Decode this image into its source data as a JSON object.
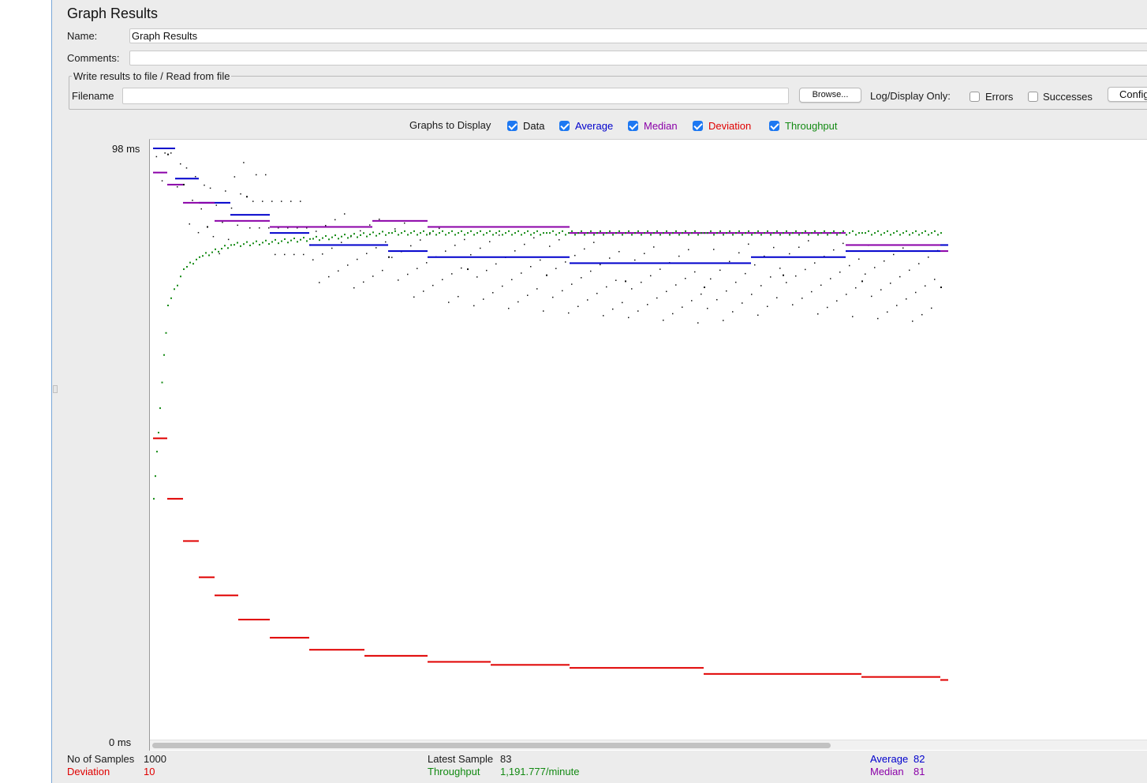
{
  "panel": {
    "title": "Graph Results"
  },
  "form": {
    "name_label": "Name:",
    "name_value": "Graph Results",
    "comments_label": "Comments:",
    "comments_value": ""
  },
  "file_group": {
    "title": "Write results to file / Read from file",
    "filename_label": "Filename",
    "filename_value": "",
    "browse_label": "Browse...",
    "log_display_label": "Log/Display Only:",
    "errors_label": "Errors",
    "errors_checked": false,
    "successes_label": "Successes",
    "successes_checked": false,
    "configure_label": "Configure"
  },
  "graphs_to_display": {
    "label": "Graphs to Display",
    "options": [
      {
        "label": "Data",
        "checked": true,
        "color": "#111111"
      },
      {
        "label": "Average",
        "checked": true,
        "color": "#0000cc"
      },
      {
        "label": "Median",
        "checked": true,
        "color": "#8a00a8"
      },
      {
        "label": "Deviation",
        "checked": true,
        "color": "#e00000"
      },
      {
        "label": "Throughput",
        "checked": true,
        "color": "#138a13"
      }
    ]
  },
  "chart_data": {
    "type": "scatter",
    "y_unit": "ms",
    "y_max_label": "98  ms",
    "y_min_label": "0  ms",
    "ylim": [
      0,
      98
    ],
    "x_samples": 1000,
    "grid": false,
    "series": [
      {
        "name": "Data",
        "color": "#111111",
        "points": [
          [
            2,
            98
          ],
          [
            20,
            97
          ],
          [
            40,
            92
          ],
          [
            70,
            85
          ],
          [
            120,
            90
          ],
          [
            200,
            82
          ],
          [
            300,
            80
          ],
          [
            400,
            78
          ],
          [
            500,
            77
          ],
          [
            600,
            76
          ],
          [
            700,
            75
          ],
          [
            800,
            77
          ],
          [
            900,
            76
          ],
          [
            1000,
            75
          ]
        ]
      },
      {
        "name": "Average",
        "color": "#0000cc",
        "points": [
          [
            2,
            98
          ],
          [
            30,
            93
          ],
          [
            60,
            89
          ],
          [
            100,
            87
          ],
          [
            150,
            84
          ],
          [
            200,
            82
          ],
          [
            300,
            81
          ],
          [
            350,
            80
          ],
          [
            530,
            79
          ],
          [
            760,
            80
          ],
          [
            880,
            81
          ],
          [
            1000,
            82
          ]
        ]
      },
      {
        "name": "Median",
        "color": "#8a00a8",
        "points": [
          [
            2,
            94
          ],
          [
            20,
            92
          ],
          [
            40,
            89
          ],
          [
            80,
            86
          ],
          [
            150,
            85
          ],
          [
            280,
            86
          ],
          [
            350,
            85
          ],
          [
            530,
            84
          ],
          [
            880,
            82
          ],
          [
            1000,
            81
          ]
        ]
      },
      {
        "name": "Deviation",
        "color": "#e00000",
        "points": [
          [
            2,
            50
          ],
          [
            20,
            40
          ],
          [
            40,
            33
          ],
          [
            60,
            27
          ],
          [
            80,
            24
          ],
          [
            110,
            20
          ],
          [
            150,
            17
          ],
          [
            200,
            15
          ],
          [
            270,
            14
          ],
          [
            350,
            13
          ],
          [
            430,
            12.5
          ],
          [
            530,
            12
          ],
          [
            700,
            11
          ],
          [
            900,
            10.5
          ],
          [
            1000,
            10
          ]
        ]
      },
      {
        "name": "Throughput",
        "color": "#138a13",
        "points": [
          [
            2,
            40
          ],
          [
            10,
            55
          ],
          [
            20,
            72
          ],
          [
            40,
            78
          ],
          [
            60,
            80
          ],
          [
            100,
            82
          ],
          [
            200,
            83
          ],
          [
            300,
            84
          ],
          [
            500,
            84
          ],
          [
            700,
            84
          ],
          [
            900,
            84
          ],
          [
            1000,
            84
          ]
        ]
      }
    ]
  },
  "stats": {
    "samples_label": "No of Samples",
    "samples_value": "1000",
    "deviation_label": "Deviation",
    "deviation_value": "10",
    "latest_label": "Latest Sample",
    "latest_value": "83",
    "throughput_label": "Throughput",
    "throughput_value": "1,191.777/minute",
    "average_label": "Average",
    "average_value": "82",
    "median_label": "Median",
    "median_value": "81"
  }
}
